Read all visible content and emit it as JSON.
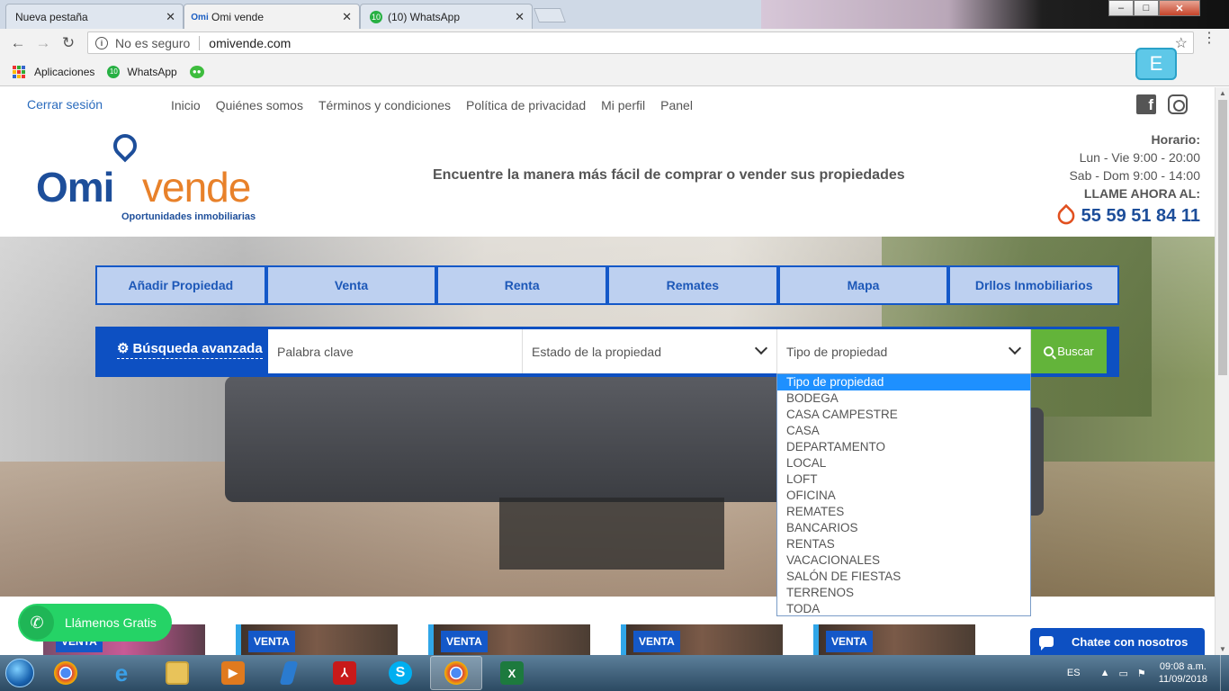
{
  "browser": {
    "tabs": [
      {
        "title": "Nueva pestaña",
        "favicon": "none",
        "active": false
      },
      {
        "title": "Omi vende",
        "favicon": "Omi",
        "active": true
      },
      {
        "title": "(10) WhatsApp",
        "favicon": "10",
        "active": false
      }
    ],
    "window_controls": {
      "minimize": "–",
      "maximize": "□",
      "close": "✕"
    },
    "security_label": "No es seguro",
    "url": "omivende.com",
    "bookmarks": [
      {
        "label": "Aplicaciones",
        "icon": "apps-grid-icon"
      },
      {
        "label": "WhatsApp",
        "icon": "whatsapp-icon",
        "badge": "10"
      }
    ],
    "extension_label": "E"
  },
  "topnav": {
    "logout": "Cerrar sesión",
    "links": [
      "Inicio",
      "Quiénes somos",
      "Términos y condiciones",
      "Política de privacidad",
      "Mi perfil",
      "Panel"
    ]
  },
  "header": {
    "logo_omi": "Omi",
    "logo_vende": "vende",
    "logo_tagline": "Oportunidades inmobiliarias",
    "tagline": "Encuentre la manera más fácil de comprar o vender sus propiedades",
    "hours_title": "Horario:",
    "hours_weekday": "Lun - Vie 9:00 - 20:00",
    "hours_weekend": "Sab - Dom 9:00 - 14:00",
    "call_label": "LLAME AHORA AL:",
    "phone": "55 59 51 84 11"
  },
  "categories": [
    "Añadir Propiedad",
    "Venta",
    "Renta",
    "Remates",
    "Mapa",
    "Drllos Inmobiliarios"
  ],
  "search": {
    "advanced_label": "Búsqueda avanzada",
    "keyword_placeholder": "Palabra clave",
    "estado_label": "Estado de la propiedad",
    "tipo_label": "Tipo de propiedad",
    "button_label": "Buscar"
  },
  "tipo_options": [
    "Tipo de propiedad",
    "BODEGA",
    "CASA CAMPESTRE",
    "CASA",
    "DEPARTAMENTO",
    "LOCAL",
    "LOFT",
    "OFICINA",
    "REMATES",
    "BANCARIOS",
    "RENTAS",
    "VACACIONALES",
    "SALÓN DE FIESTAS",
    "TERRENOS",
    "TODA"
  ],
  "listings": {
    "badge": "VENTA",
    "count": 5
  },
  "call_button": "Llámenos Gratis",
  "chat_button": "Chatee con nosotros",
  "taskbar": {
    "apps": [
      "chrome-icon",
      "ie-icon",
      "explorer-icon",
      "media-player-icon",
      "app-icon",
      "pdf-icon",
      "skype-icon",
      "chrome-icon",
      "excel-icon"
    ],
    "language": "ES",
    "time": "09:08 a.m.",
    "date": "11/09/2018"
  },
  "colors": {
    "brand_blue": "#1d4e9a",
    "brand_orange": "#e8812a",
    "search_blue": "#0d50c2",
    "buscar_green": "#63b43a",
    "whatsapp_green": "#25d366"
  }
}
